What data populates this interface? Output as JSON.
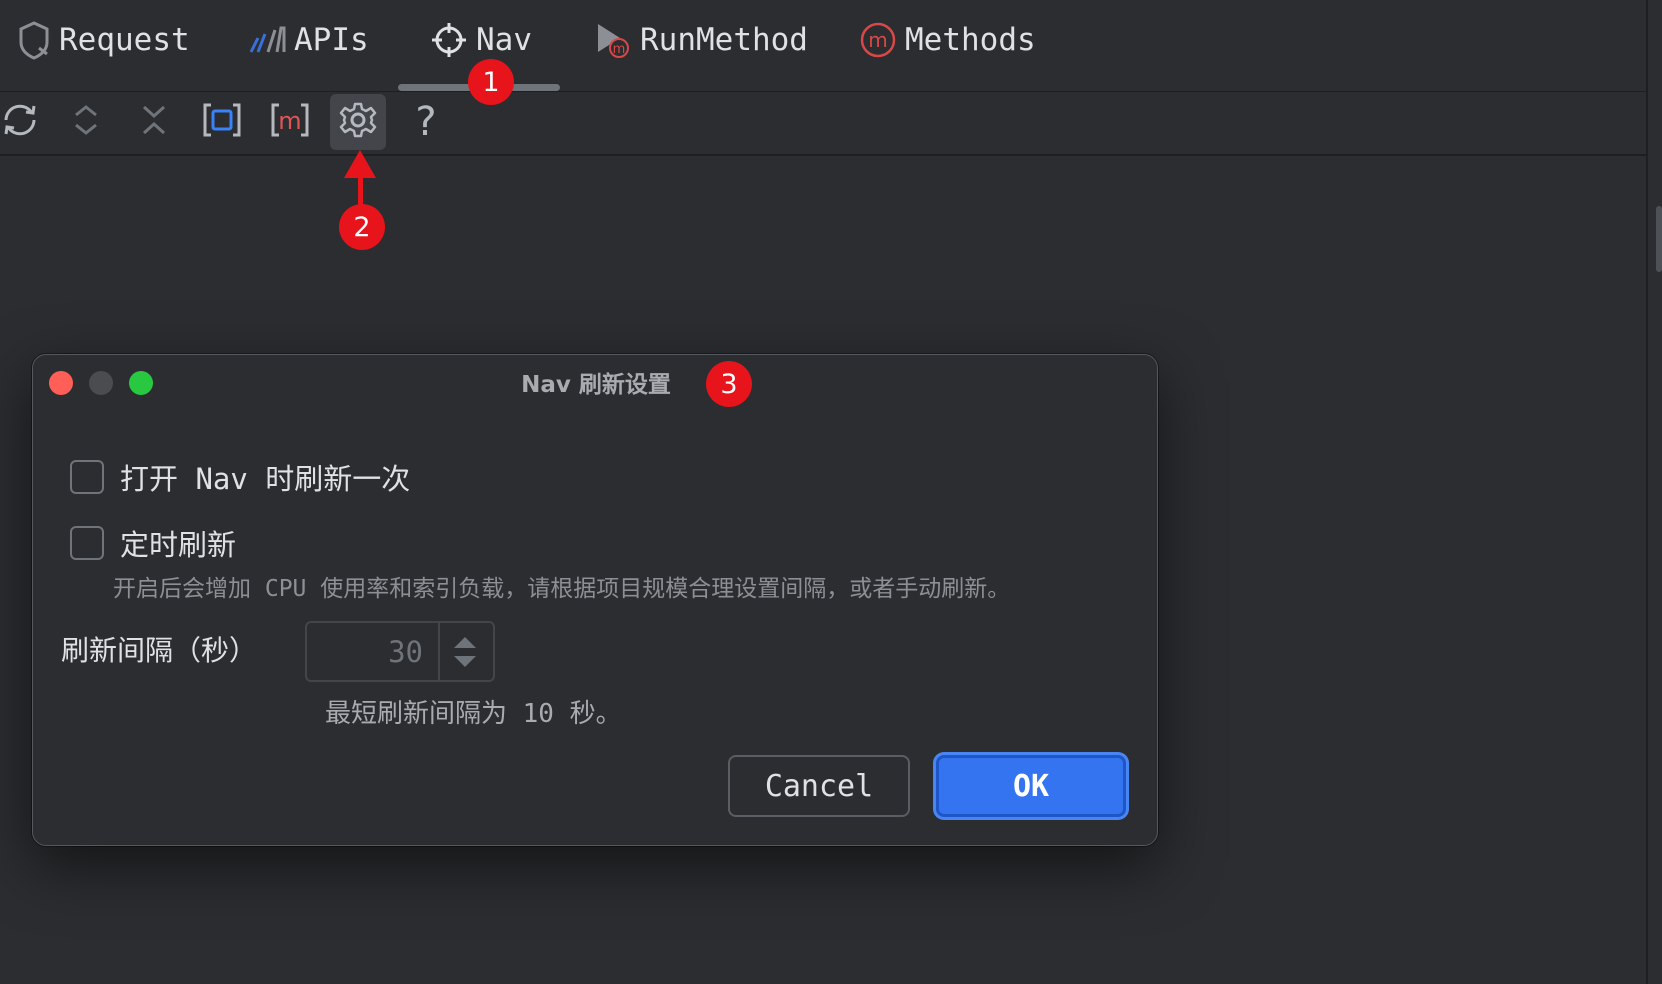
{
  "tabs": [
    {
      "label": "Request",
      "icon": "shield-icon"
    },
    {
      "label": "APIs",
      "icon": "api-bars-icon"
    },
    {
      "label": "Nav",
      "icon": "crosshair-icon",
      "selected": true
    },
    {
      "label": "RunMethod",
      "icon": "run-method-icon"
    },
    {
      "label": "Methods",
      "icon": "methods-icon"
    }
  ],
  "toolbar": {
    "buttons": [
      {
        "icon": "refresh-icon"
      },
      {
        "icon": "expand-collapse-icon"
      },
      {
        "icon": "collapse-all-icon"
      },
      {
        "icon": "select-in-editor-icon"
      },
      {
        "icon": "method-marker-icon"
      },
      {
        "icon": "gear-icon",
        "active": true
      },
      {
        "icon": "help-icon",
        "label": "?"
      }
    ]
  },
  "annotations": {
    "step1": "1",
    "step2": "2",
    "step3": "3",
    "color": "#e8141b"
  },
  "dialog": {
    "title": "Nav 刷新设置",
    "option_refresh_on_open": {
      "label": "打开 Nav 时刷新一次",
      "checked": false
    },
    "option_timed_refresh": {
      "label": "定时刷新",
      "checked": false
    },
    "timed_refresh_hint": "开启后会增加 CPU 使用率和索引负载，请根据项目规模合理设置间隔，或者手动刷新。",
    "interval_label": "刷新间隔（秒）",
    "interval_value": "30",
    "interval_hint": "最短刷新间隔为 10 秒。",
    "cancel_label": "Cancel",
    "ok_label": "OK"
  },
  "colors": {
    "background": "#2b2d30",
    "accent": "#3574f0",
    "traffic_close": "#ff5f57",
    "traffic_minimize": "#4a4c50",
    "traffic_zoom": "#28c840"
  }
}
